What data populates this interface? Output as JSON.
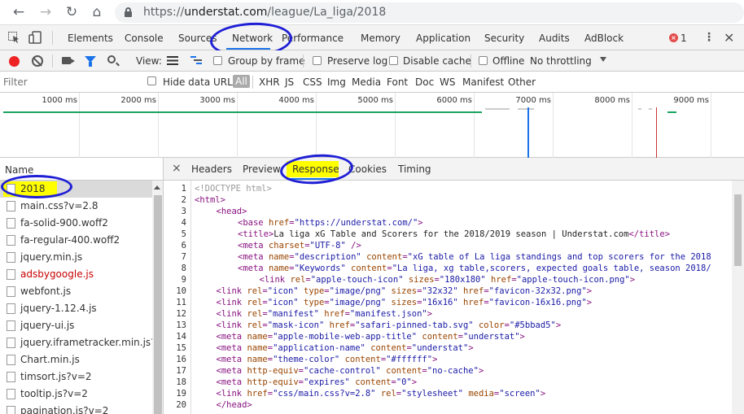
{
  "browser": {
    "url_scheme": "https://",
    "url_host": "understat.com",
    "url_path": "/league/La_liga/2018"
  },
  "devtools": {
    "tabs": [
      "Elements",
      "Console",
      "Sources",
      "Network",
      "Performance",
      "Memory",
      "Application",
      "Security",
      "Audits",
      "AdBlock"
    ],
    "active_tab": "Network",
    "error_count": "1",
    "error_badge": "×"
  },
  "network_toolbar": {
    "view_label": "View:",
    "group_by_frame": "Group by frame",
    "preserve_log": "Preserve log",
    "disable_cache": "Disable cache",
    "offline": "Offline",
    "throttling": "No throttling"
  },
  "filter_bar": {
    "placeholder": "Filter",
    "hide_data_urls": "Hide data URLs",
    "types": [
      "All",
      "XHR",
      "JS",
      "CSS",
      "Img",
      "Media",
      "Font",
      "Doc",
      "WS",
      "Manifest",
      "Other"
    ],
    "active_type": "All"
  },
  "timeline": {
    "ticks": [
      "1000 ms",
      "2000 ms",
      "3000 ms",
      "4000 ms",
      "5000 ms",
      "6000 ms",
      "7000 ms",
      "8000 ms",
      "9000 ms"
    ]
  },
  "request_list": {
    "header": "Name",
    "items": [
      {
        "name": "2018",
        "selected": true,
        "error": false
      },
      {
        "name": "main.css?v=2.8",
        "selected": false,
        "error": false
      },
      {
        "name": "fa-solid-900.woff2",
        "selected": false,
        "error": false
      },
      {
        "name": "fa-regular-400.woff2",
        "selected": false,
        "error": false
      },
      {
        "name": "jquery.min.js",
        "selected": false,
        "error": false
      },
      {
        "name": "adsbygoogle.js",
        "selected": false,
        "error": true
      },
      {
        "name": "webfont.js",
        "selected": false,
        "error": false
      },
      {
        "name": "jquery-1.12.4.js",
        "selected": false,
        "error": false
      },
      {
        "name": "jquery-ui.js",
        "selected": false,
        "error": false
      },
      {
        "name": "jquery.iframetracker.min.js?v=2",
        "selected": false,
        "error": false
      },
      {
        "name": "Chart.min.js",
        "selected": false,
        "error": false
      },
      {
        "name": "timsort.js?v=2",
        "selected": false,
        "error": false
      },
      {
        "name": "tooltip.js?v=2",
        "selected": false,
        "error": false
      },
      {
        "name": "pagination.js?v=2",
        "selected": false,
        "error": false
      }
    ]
  },
  "detail": {
    "tabs": [
      "Headers",
      "Preview",
      "Response",
      "Cookies",
      "Timing"
    ],
    "active_tab": "Response",
    "close_glyph": "×",
    "lines": [
      {
        "n": "1",
        "indent": 0,
        "html": "<span class=\"cmt\">&lt;!DOCTYPE html&gt;</span>"
      },
      {
        "n": "2",
        "indent": 0,
        "html": "<span class=\"tag\">&lt;html&gt;</span>"
      },
      {
        "n": "3",
        "indent": 1,
        "html": "<span class=\"tag\">&lt;head&gt;</span>"
      },
      {
        "n": "4",
        "indent": 2,
        "html": "<span class=\"tag\">&lt;base</span> <span class=\"attr\">href</span>=<span class=\"val\">\"https://understat.com/\"</span><span class=\"tag\">&gt;</span>"
      },
      {
        "n": "5",
        "indent": 2,
        "html": "<span class=\"tag\">&lt;title&gt;</span><span class=\"txt\">La liga xG Table and Scorers for the 2018/2019 season | Understat.com</span><span class=\"tag\">&lt;/title&gt;</span>"
      },
      {
        "n": "6",
        "indent": 2,
        "html": "<span class=\"tag\">&lt;meta</span> <span class=\"attr\">charset</span>=<span class=\"val\">\"UTF-8\"</span> <span class=\"tag\">/&gt;</span>"
      },
      {
        "n": "7",
        "indent": 2,
        "html": "<span class=\"tag\">&lt;meta</span> <span class=\"attr\">name</span>=<span class=\"val\">\"description\"</span> <span class=\"attr\">content</span>=<span class=\"val\">\"xG table of La liga standings and top scorers for the 2018</span>"
      },
      {
        "n": "8",
        "indent": 2,
        "html": "<span class=\"tag\">&lt;meta</span> <span class=\"attr\">name</span>=<span class=\"val\">\"Keywords\"</span> <span class=\"attr\">content</span>=<span class=\"val\">\"La liga, xg table,scorers, expected goals table, season 2018/</span>"
      },
      {
        "n": "9",
        "indent": 3,
        "html": "<span class=\"tag\">&lt;link</span> <span class=\"attr\">rel</span>=<span class=\"val\">\"apple-touch-icon\"</span> <span class=\"attr\">sizes</span>=<span class=\"val\">\"180x180\"</span> <span class=\"attr\">href</span>=<span class=\"val\">\"apple-touch-icon.png\"</span><span class=\"tag\">&gt;</span>"
      },
      {
        "n": "10",
        "indent": 1,
        "html": "<span class=\"tag\">&lt;link</span> <span class=\"attr\">rel</span>=<span class=\"val\">\"icon\"</span> <span class=\"attr\">type</span>=<span class=\"val\">\"image/png\"</span> <span class=\"attr\">sizes</span>=<span class=\"val\">\"32x32\"</span> <span class=\"attr\">href</span>=<span class=\"val\">\"favicon-32x32.png\"</span><span class=\"tag\">&gt;</span>"
      },
      {
        "n": "11",
        "indent": 1,
        "html": "<span class=\"tag\">&lt;link</span> <span class=\"attr\">rel</span>=<span class=\"val\">\"icon\"</span> <span class=\"attr\">type</span>=<span class=\"val\">\"image/png\"</span> <span class=\"attr\">sizes</span>=<span class=\"val\">\"16x16\"</span> <span class=\"attr\">href</span>=<span class=\"val\">\"favicon-16x16.png\"</span><span class=\"tag\">&gt;</span>"
      },
      {
        "n": "12",
        "indent": 1,
        "html": "<span class=\"tag\">&lt;link</span> <span class=\"attr\">rel</span>=<span class=\"val\">\"manifest\"</span> <span class=\"attr\">href</span>=<span class=\"val\">\"manifest.json\"</span><span class=\"tag\">&gt;</span>"
      },
      {
        "n": "13",
        "indent": 1,
        "html": "<span class=\"tag\">&lt;link</span> <span class=\"attr\">rel</span>=<span class=\"val\">\"mask-icon\"</span> <span class=\"attr\">href</span>=<span class=\"val\">\"safari-pinned-tab.svg\"</span> <span class=\"attr\">color</span>=<span class=\"val\">\"#5bbad5\"</span><span class=\"tag\">&gt;</span>"
      },
      {
        "n": "14",
        "indent": 1,
        "html": "<span class=\"tag\">&lt;meta</span> <span class=\"attr\">name</span>=<span class=\"val\">\"apple-mobile-web-app-title\"</span> <span class=\"attr\">content</span>=<span class=\"val\">\"understat\"</span><span class=\"tag\">&gt;</span>"
      },
      {
        "n": "15",
        "indent": 1,
        "html": "<span class=\"tag\">&lt;meta</span> <span class=\"attr\">name</span>=<span class=\"val\">\"application-name\"</span> <span class=\"attr\">content</span>=<span class=\"val\">\"understat\"</span><span class=\"tag\">&gt;</span>"
      },
      {
        "n": "16",
        "indent": 1,
        "html": "<span class=\"tag\">&lt;meta</span> <span class=\"attr\">name</span>=<span class=\"val\">\"theme-color\"</span> <span class=\"attr\">content</span>=<span class=\"val\">\"#ffffff\"</span><span class=\"tag\">&gt;</span>"
      },
      {
        "n": "17",
        "indent": 1,
        "html": "<span class=\"tag\">&lt;meta</span> <span class=\"attr\">http-equiv</span>=<span class=\"val\">\"cache-control\"</span> <span class=\"attr\">content</span>=<span class=\"val\">\"no-cache\"</span><span class=\"tag\">&gt;</span>"
      },
      {
        "n": "18",
        "indent": 1,
        "html": "<span class=\"tag\">&lt;meta</span> <span class=\"attr\">http-equiv</span>=<span class=\"val\">\"expires\"</span> <span class=\"attr\">content</span>=<span class=\"val\">\"0\"</span><span class=\"tag\">&gt;</span>"
      },
      {
        "n": "19",
        "indent": 1,
        "html": "<span class=\"tag\">&lt;link</span> <span class=\"attr\">href</span>=<span class=\"val\">\"css/main.css?v=2.8\"</span> <span class=\"attr\">rel</span>=<span class=\"val\">\"stylesheet\"</span> <span class=\"attr\">media</span>=<span class=\"val\">\"screen\"</span><span class=\"tag\">&gt;</span>"
      },
      {
        "n": "20",
        "indent": 1,
        "html": "<span class=\"tag\">&lt;/head&gt;</span>"
      }
    ]
  },
  "colors": {
    "highlight": "#ffff00",
    "annotation_ring": "#1f1fd6",
    "error_red": "#c80000",
    "record_red": "#e22222",
    "accent_blue": "#1a73e8"
  }
}
